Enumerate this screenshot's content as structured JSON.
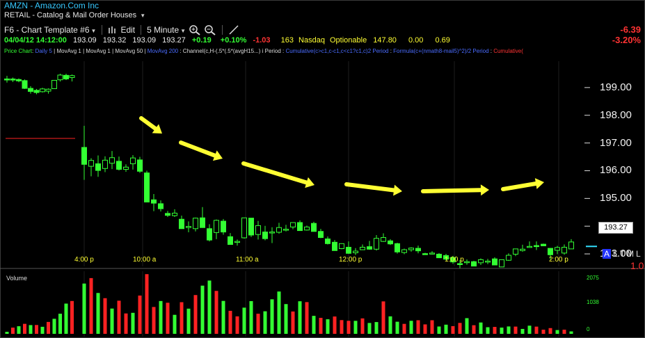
{
  "header": {
    "symbol": "AMZN",
    "company": "Amazon.Com Inc",
    "sector": "RETAIL - Catalog & Mail Order Houses",
    "template": "F6 - Chart Template #6",
    "edit_label": "Edit",
    "interval": "5 Minute",
    "change_abs": "-6.39",
    "change_pct": "-3.20%"
  },
  "quote": {
    "datetime": "04/04/12 14:12:00",
    "open": "193.09",
    "high": "193.32",
    "low": "193.09",
    "close": "193.27",
    "change": "+0.19",
    "change_pct": "+0.10%",
    "extra": "-1.03",
    "count": "163",
    "exchange": "Nasdaq",
    "optionable": "Optionable",
    "v1": "147.80",
    "v2": "0.00",
    "v3": "0.69"
  },
  "studies": {
    "price_chart": "Price Chart",
    "daily": "Daily 5",
    "movavg1": "MovAvg 1",
    "movavg2": "MovAvg 1",
    "movavg3": "MovAvg 50",
    "movavg4": "MovAvg 200",
    "channel": "Channel(c,H-(.5*(.5*(avgH15...)",
    "period": "Period",
    "cumulative1": "Cumulative(c>c1,c-c1,c<c1?c1,c)2 Period",
    "formula": "Formula(c+(nmath8-mail5)^2)/2 Period",
    "cumulative2": "Cumulative("
  },
  "colors": {
    "up": "#33ff33",
    "down": "#ff2222",
    "arrow": "#ffff33",
    "accent": "#36c8ff",
    "last": "#33e0ff"
  },
  "price_axis": {
    "labels": [
      "199.00",
      "198.00",
      "197.00",
      "196.00",
      "195.00",
      "194.00",
      "193.00"
    ],
    "last": "193.27"
  },
  "time_axis": {
    "labels": [
      "4:00 p",
      "10:00 a",
      "11:00 a",
      "12:00 p",
      "1:00 p",
      "2:00 p"
    ]
  },
  "panel_buttons": {
    "a": "A",
    "l": "L",
    "t": "T",
    "m": "M",
    "l2": "L",
    "scale": "1.0"
  },
  "volume": {
    "title": "Volume",
    "axis": [
      "2075",
      "1038",
      "0"
    ]
  },
  "chart_data": {
    "type": "candlestick",
    "ylim": [
      192.55,
      199.95
    ],
    "x_ticks": [
      "4:00 p",
      "10:00 a",
      "11:00 a",
      "12:00 p",
      "1:00 p",
      "2:00 p"
    ],
    "candles": [
      {
        "o": 199.31,
        "h": 199.42,
        "l": 199.18,
        "c": 199.3
      },
      {
        "o": 199.31,
        "h": 199.36,
        "l": 199.2,
        "c": 199.27
      },
      {
        "o": 199.29,
        "h": 199.33,
        "l": 199.19,
        "c": 199.24
      },
      {
        "o": 199.25,
        "h": 199.29,
        "l": 198.95,
        "c": 198.97
      },
      {
        "o": 198.97,
        "h": 199.05,
        "l": 198.78,
        "c": 198.86
      },
      {
        "o": 198.9,
        "h": 198.95,
        "l": 198.76,
        "c": 198.82
      },
      {
        "o": 198.85,
        "h": 198.99,
        "l": 198.82,
        "c": 198.95
      },
      {
        "o": 198.87,
        "h": 198.97,
        "l": 198.78,
        "c": 198.94
      },
      {
        "o": 198.96,
        "h": 199.26,
        "l": 198.96,
        "c": 199.26
      },
      {
        "o": 199.28,
        "h": 199.5,
        "l": 199.22,
        "c": 199.45
      },
      {
        "o": 199.44,
        "h": 199.5,
        "l": 199.27,
        "c": 199.31
      },
      {
        "o": 199.36,
        "h": 199.47,
        "l": 199.22,
        "c": 199.43
      },
      {
        "o": 196.84,
        "h": 197.62,
        "l": 195.67,
        "c": 196.23
      },
      {
        "o": 196.16,
        "h": 196.45,
        "l": 195.8,
        "c": 196.37
      },
      {
        "o": 196.25,
        "h": 196.55,
        "l": 195.78,
        "c": 196.01
      },
      {
        "o": 196.08,
        "h": 196.52,
        "l": 195.95,
        "c": 196.38
      },
      {
        "o": 196.27,
        "h": 196.71,
        "l": 196.06,
        "c": 196.47
      },
      {
        "o": 196.34,
        "h": 196.51,
        "l": 196.01,
        "c": 196.05
      },
      {
        "o": 196.05,
        "h": 196.23,
        "l": 195.96,
        "c": 196.13
      },
      {
        "o": 196.25,
        "h": 196.56,
        "l": 196.04,
        "c": 196.46
      },
      {
        "o": 196.39,
        "h": 196.5,
        "l": 195.92,
        "c": 195.98
      },
      {
        "o": 195.92,
        "h": 196.0,
        "l": 194.87,
        "c": 194.87
      },
      {
        "o": 194.95,
        "h": 195.16,
        "l": 194.54,
        "c": 194.83
      },
      {
        "o": 194.81,
        "h": 194.93,
        "l": 194.53,
        "c": 194.63
      },
      {
        "o": 194.46,
        "h": 194.55,
        "l": 194.33,
        "c": 194.39
      },
      {
        "o": 194.38,
        "h": 194.61,
        "l": 194.33,
        "c": 194.47
      },
      {
        "o": 194.25,
        "h": 194.38,
        "l": 193.91,
        "c": 193.91
      },
      {
        "o": 193.95,
        "h": 194.17,
        "l": 193.78,
        "c": 193.99
      },
      {
        "o": 193.91,
        "h": 194.31,
        "l": 193.81,
        "c": 194.29
      },
      {
        "o": 194.3,
        "h": 194.69,
        "l": 193.94,
        "c": 193.95
      },
      {
        "o": 193.91,
        "h": 194.07,
        "l": 193.45,
        "c": 193.5
      },
      {
        "o": 193.77,
        "h": 194.24,
        "l": 193.53,
        "c": 194.21
      },
      {
        "o": 194.18,
        "h": 194.26,
        "l": 193.69,
        "c": 193.79
      },
      {
        "o": 193.62,
        "h": 193.75,
        "l": 193.34,
        "c": 193.34
      },
      {
        "o": 193.44,
        "h": 193.52,
        "l": 193.3,
        "c": 193.45
      },
      {
        "o": 193.58,
        "h": 194.3,
        "l": 193.55,
        "c": 194.3
      },
      {
        "o": 194.29,
        "h": 194.27,
        "l": 193.61,
        "c": 193.68
      },
      {
        "o": 193.7,
        "h": 194.19,
        "l": 193.52,
        "c": 194.02
      },
      {
        "o": 193.79,
        "h": 194.01,
        "l": 193.49,
        "c": 193.55
      },
      {
        "o": 193.77,
        "h": 193.96,
        "l": 193.39,
        "c": 193.79
      },
      {
        "o": 193.78,
        "h": 194.12,
        "l": 193.73,
        "c": 193.95
      },
      {
        "o": 193.86,
        "h": 194.05,
        "l": 193.81,
        "c": 193.89
      },
      {
        "o": 193.97,
        "h": 194.13,
        "l": 193.89,
        "c": 194.13
      },
      {
        "o": 194.13,
        "h": 194.21,
        "l": 193.84,
        "c": 193.84
      },
      {
        "o": 193.86,
        "h": 194.02,
        "l": 193.84,
        "c": 193.97
      },
      {
        "o": 194.1,
        "h": 194.16,
        "l": 193.81,
        "c": 193.81
      },
      {
        "o": 193.81,
        "h": 193.9,
        "l": 193.57,
        "c": 193.59
      },
      {
        "o": 193.54,
        "h": 193.63,
        "l": 193.34,
        "c": 193.37
      },
      {
        "o": 193.42,
        "h": 193.5,
        "l": 193.12,
        "c": 193.12
      },
      {
        "o": 193.19,
        "h": 193.38,
        "l": 193.17,
        "c": 193.37
      },
      {
        "o": 193.24,
        "h": 193.45,
        "l": 193.0,
        "c": 193.02
      },
      {
        "o": 193.04,
        "h": 193.21,
        "l": 192.96,
        "c": 193.1
      },
      {
        "o": 193.15,
        "h": 193.34,
        "l": 193.14,
        "c": 193.24
      },
      {
        "o": 193.26,
        "h": 193.47,
        "l": 193.15,
        "c": 193.17
      },
      {
        "o": 193.17,
        "h": 193.68,
        "l": 193.12,
        "c": 193.56
      },
      {
        "o": 193.45,
        "h": 193.74,
        "l": 193.43,
        "c": 193.59
      },
      {
        "o": 193.47,
        "h": 193.53,
        "l": 193.32,
        "c": 193.36
      },
      {
        "o": 193.37,
        "h": 193.4,
        "l": 193.01,
        "c": 193.07
      },
      {
        "o": 193.05,
        "h": 193.19,
        "l": 192.99,
        "c": 193.15
      },
      {
        "o": 193.15,
        "h": 193.24,
        "l": 193.08,
        "c": 193.21
      },
      {
        "o": 193.2,
        "h": 193.3,
        "l": 193.02,
        "c": 193.11
      },
      {
        "o": 193.01,
        "h": 193.04,
        "l": 192.99,
        "c": 192.99
      },
      {
        "o": 193.03,
        "h": 193.1,
        "l": 192.98,
        "c": 193.03
      },
      {
        "o": 192.99,
        "h": 193.03,
        "l": 192.85,
        "c": 192.86
      },
      {
        "o": 192.94,
        "h": 193.0,
        "l": 192.77,
        "c": 192.81
      },
      {
        "o": 192.87,
        "h": 192.93,
        "l": 192.64,
        "c": 192.71
      },
      {
        "o": 192.65,
        "h": 192.78,
        "l": 192.47,
        "c": 192.63
      },
      {
        "o": 192.72,
        "h": 192.8,
        "l": 192.61,
        "c": 192.72
      },
      {
        "o": 192.72,
        "h": 192.75,
        "l": 192.56,
        "c": 192.56
      },
      {
        "o": 192.68,
        "h": 192.84,
        "l": 192.6,
        "c": 192.79
      },
      {
        "o": 192.73,
        "h": 192.82,
        "l": 192.63,
        "c": 192.74
      },
      {
        "o": 192.82,
        "h": 192.88,
        "l": 192.6,
        "c": 192.6
      },
      {
        "o": 192.53,
        "h": 192.79,
        "l": 192.53,
        "c": 192.79
      },
      {
        "o": 192.77,
        "h": 193.02,
        "l": 192.75,
        "c": 192.95
      },
      {
        "o": 192.99,
        "h": 193.19,
        "l": 192.92,
        "c": 193.18
      },
      {
        "o": 193.12,
        "h": 193.33,
        "l": 193.08,
        "c": 193.17
      },
      {
        "o": 193.25,
        "h": 193.45,
        "l": 193.23,
        "c": 193.27
      },
      {
        "o": 193.3,
        "h": 193.45,
        "l": 193.14,
        "c": 193.28
      },
      {
        "o": 193.35,
        "h": 193.37,
        "l": 193.29,
        "c": 193.29
      },
      {
        "o": 193.2,
        "h": 193.21,
        "l": 192.8,
        "c": 192.97
      },
      {
        "o": 193.13,
        "h": 193.29,
        "l": 192.99,
        "c": 193.23
      },
      {
        "o": 193.03,
        "h": 193.34,
        "l": 192.97,
        "c": 193.24
      },
      {
        "o": 193.18,
        "h": 193.53,
        "l": 193.18,
        "c": 193.43
      }
    ],
    "volume_ylim": [
      0,
      2075
    ],
    "volume": [
      {
        "v": 71,
        "d": 0
      },
      {
        "v": 223,
        "d": 1
      },
      {
        "v": 273,
        "d": 0
      },
      {
        "v": 359,
        "d": 1
      },
      {
        "v": 314,
        "d": 0
      },
      {
        "v": 317,
        "d": 1
      },
      {
        "v": 253,
        "d": 0
      },
      {
        "v": 428,
        "d": 1
      },
      {
        "v": 540,
        "d": 0
      },
      {
        "v": 723,
        "d": 0
      },
      {
        "v": 1087,
        "d": 0
      },
      {
        "v": 1180,
        "d": 1
      },
      {
        "v": 1807,
        "d": 0
      },
      {
        "v": 2003,
        "d": 1
      },
      {
        "v": 1468,
        "d": 0
      },
      {
        "v": 1281,
        "d": 1
      },
      {
        "v": 908,
        "d": 0
      },
      {
        "v": 1191,
        "d": 1
      },
      {
        "v": 732,
        "d": 1
      },
      {
        "v": 755,
        "d": 0
      },
      {
        "v": 1376,
        "d": 1
      },
      {
        "v": 2145,
        "d": 1
      },
      {
        "v": 965,
        "d": 1
      },
      {
        "v": 1179,
        "d": 0
      },
      {
        "v": 1117,
        "d": 1
      },
      {
        "v": 683,
        "d": 0
      },
      {
        "v": 1137,
        "d": 1
      },
      {
        "v": 905,
        "d": 0
      },
      {
        "v": 1394,
        "d": 1
      },
      {
        "v": 1732,
        "d": 0
      },
      {
        "v": 1915,
        "d": 0
      },
      {
        "v": 1543,
        "d": 1
      },
      {
        "v": 1183,
        "d": 0
      },
      {
        "v": 827,
        "d": 1
      },
      {
        "v": 628,
        "d": 1
      },
      {
        "v": 941,
        "d": 0
      },
      {
        "v": 1176,
        "d": 0
      },
      {
        "v": 723,
        "d": 1
      },
      {
        "v": 810,
        "d": 0
      },
      {
        "v": 1241,
        "d": 0
      },
      {
        "v": 1521,
        "d": 0
      },
      {
        "v": 1069,
        "d": 0
      },
      {
        "v": 803,
        "d": 1
      },
      {
        "v": 1171,
        "d": 0
      },
      {
        "v": 1140,
        "d": 1
      },
      {
        "v": 646,
        "d": 0
      },
      {
        "v": 575,
        "d": 1
      },
      {
        "v": 523,
        "d": 0
      },
      {
        "v": 623,
        "d": 1
      },
      {
        "v": 493,
        "d": 1
      },
      {
        "v": 468,
        "d": 1
      },
      {
        "v": 467,
        "d": 0
      },
      {
        "v": 555,
        "d": 1
      },
      {
        "v": 390,
        "d": 0
      },
      {
        "v": 423,
        "d": 0
      },
      {
        "v": 1166,
        "d": 1
      },
      {
        "v": 628,
        "d": 0
      },
      {
        "v": 435,
        "d": 0
      },
      {
        "v": 358,
        "d": 1
      },
      {
        "v": 468,
        "d": 0
      },
      {
        "v": 488,
        "d": 1
      },
      {
        "v": 339,
        "d": 1
      },
      {
        "v": 488,
        "d": 1
      },
      {
        "v": 263,
        "d": 0
      },
      {
        "v": 329,
        "d": 0
      },
      {
        "v": 277,
        "d": 1
      },
      {
        "v": 392,
        "d": 1
      },
      {
        "v": 563,
        "d": 0
      },
      {
        "v": 309,
        "d": 1
      },
      {
        "v": 407,
        "d": 0
      },
      {
        "v": 237,
        "d": 0
      },
      {
        "v": 249,
        "d": 1
      },
      {
        "v": 224,
        "d": 0
      },
      {
        "v": 265,
        "d": 0
      },
      {
        "v": 260,
        "d": 1
      },
      {
        "v": 176,
        "d": 0
      },
      {
        "v": 293,
        "d": 0
      },
      {
        "v": 259,
        "d": 1
      },
      {
        "v": 149,
        "d": 1
      },
      {
        "v": 206,
        "d": 1
      },
      {
        "v": 135,
        "d": 0
      },
      {
        "v": 149,
        "d": 1
      },
      {
        "v": 87,
        "d": 0
      }
    ]
  }
}
